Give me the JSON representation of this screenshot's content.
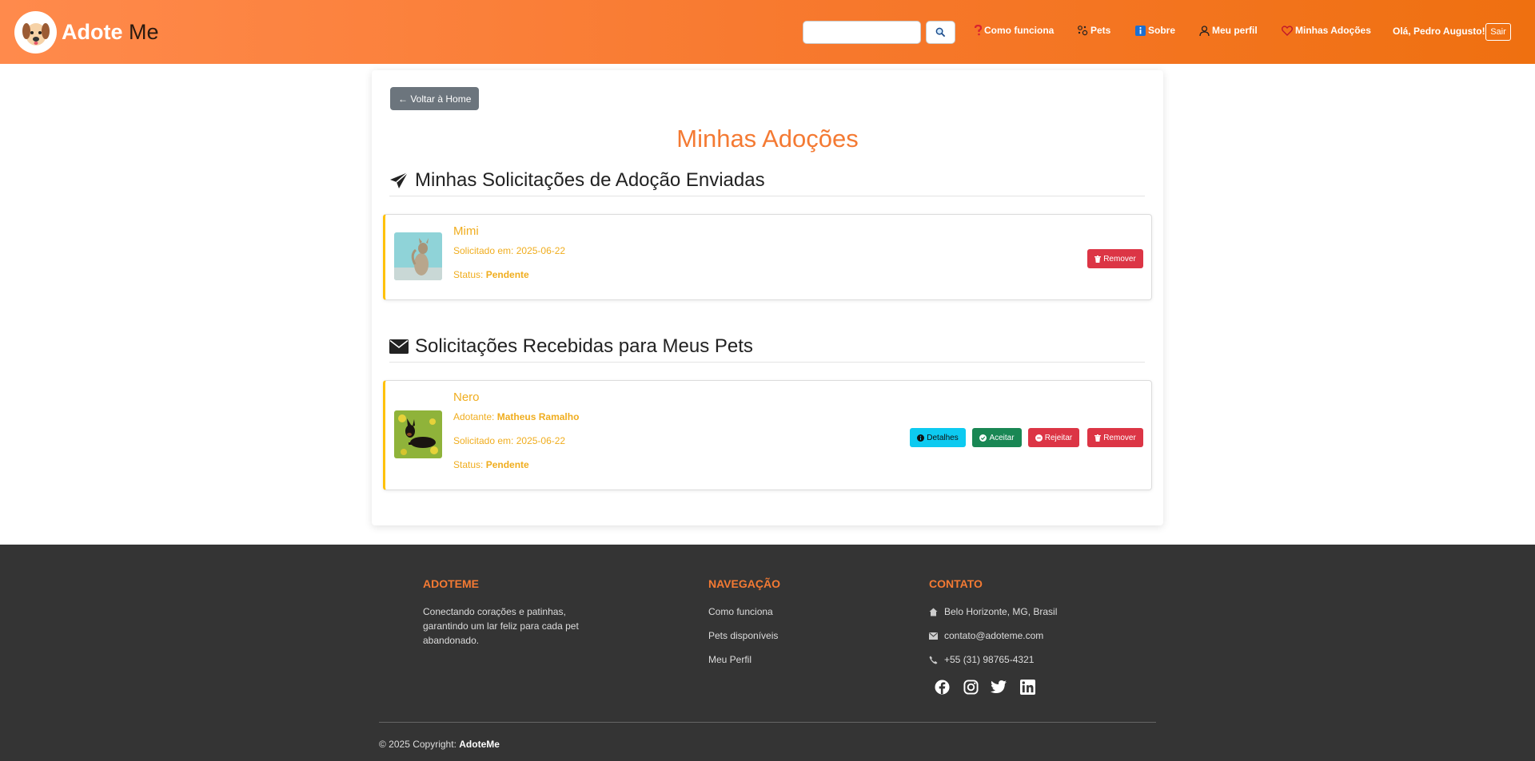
{
  "header": {
    "brand_bold": "Adote",
    "brand_light": "Me",
    "search_placeholder": "",
    "nav": {
      "como_funciona": "Como funciona",
      "pets": "Pets",
      "sobre": "Sobre",
      "meu_perfil": "Meu perfil",
      "minhas_adocoes": "Minhas Adoções"
    },
    "greeting": "Olá, Pedro Augusto!",
    "logout": "Sair"
  },
  "main": {
    "back_button": "← Voltar à Home",
    "title": "Minhas Adoções",
    "sent_section": {
      "heading": "Minhas Solicitações de Adoção Enviadas",
      "items": [
        {
          "pet_name": "Mimi",
          "requested_label": "Solicitado em:",
          "requested_date": "2025-06-22",
          "status_label": "Status:",
          "status": "Pendente",
          "remove_label": "Remover"
        }
      ]
    },
    "received_section": {
      "heading": "Solicitações Recebidas para Meus Pets",
      "items": [
        {
          "pet_name": "Nero",
          "adopter_label": "Adotante:",
          "adopter": "Matheus Ramalho",
          "requested_label": "Solicitado em:",
          "requested_date": "2025-06-22",
          "status_label": "Status:",
          "status": "Pendente",
          "details_label": "Detalhes",
          "accept_label": "Aceitar",
          "reject_label": "Rejeitar",
          "remove_label": "Remover"
        }
      ]
    }
  },
  "footer": {
    "about_heading": "ADOTEME",
    "about_line1": "Conectando corações e patinhas,",
    "about_line2": "garantindo um lar feliz para cada pet",
    "about_line3": "abandonado.",
    "nav_heading": "NAVEGAÇÃO",
    "nav_links": [
      "Como funciona",
      "Pets disponíveis",
      "Meu Perfil"
    ],
    "contact_heading": "CONTATO",
    "address": "Belo Horizonte, MG, Brasil",
    "email": "contato@adoteme.com",
    "phone": "+55 (31) 98765-4321",
    "copyright_prefix": "© 2025 Copyright:",
    "copyright_brand": "AdoteMe"
  },
  "colors": {
    "brand_orange": "#f47a33",
    "pending_yellow": "#f0ad1e",
    "danger": "#dc3545",
    "info": "#0dcaf0",
    "success": "#198754",
    "footer_bg": "#343434"
  },
  "icons": [
    "dog-logo-icon",
    "search-icon",
    "question-icon",
    "paw-icon",
    "info-icon",
    "user-icon",
    "heart-icon",
    "paper-plane-icon",
    "envelope-icon",
    "trash-icon",
    "info-circle-icon",
    "check-circle-icon",
    "x-circle-icon",
    "home-icon",
    "mail-icon",
    "phone-icon",
    "facebook-icon",
    "instagram-icon",
    "twitter-icon",
    "linkedin-icon"
  ]
}
